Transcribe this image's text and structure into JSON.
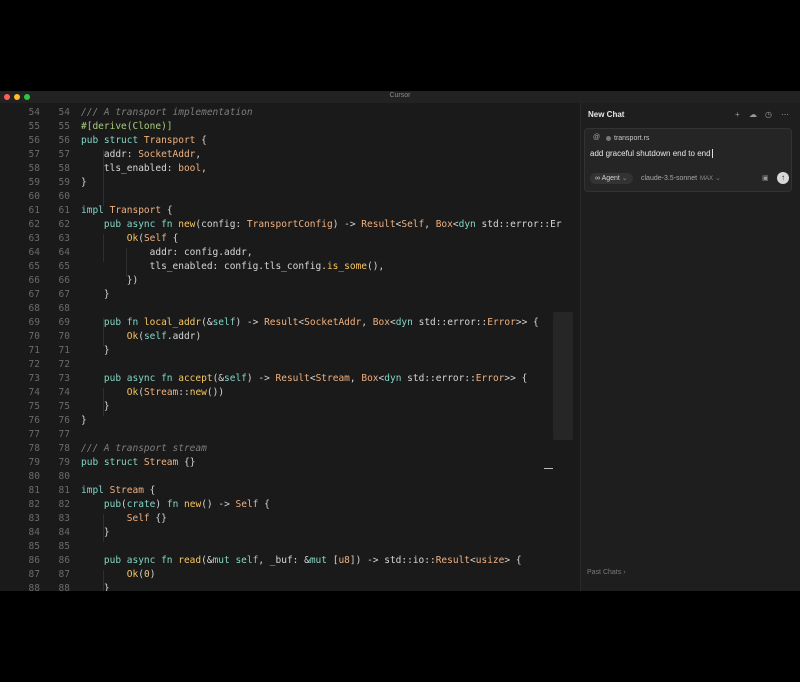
{
  "window": {
    "title": "Cursor"
  },
  "editor": {
    "lines": [
      {
        "n": "54",
        "tokens": [
          {
            "t": "/// A transport implementation",
            "c": "cm"
          }
        ]
      },
      {
        "n": "55",
        "tokens": [
          {
            "t": "#[derive(Clone)]",
            "c": "mac"
          }
        ]
      },
      {
        "n": "56",
        "tokens": [
          {
            "t": "pub struct ",
            "c": "kw"
          },
          {
            "t": "Transport",
            "c": "ty"
          },
          {
            "t": " {"
          }
        ]
      },
      {
        "n": "57",
        "tokens": [
          {
            "t": "    addr: "
          },
          {
            "t": "SocketAddr",
            "c": "ty"
          },
          {
            "t": ","
          }
        ]
      },
      {
        "n": "58",
        "tokens": [
          {
            "t": "    tls_enabled: "
          },
          {
            "t": "bool",
            "c": "ty"
          },
          {
            "t": ","
          }
        ]
      },
      {
        "n": "59",
        "tokens": [
          {
            "t": "}"
          }
        ]
      },
      {
        "n": "60",
        "tokens": []
      },
      {
        "n": "61",
        "tokens": [
          {
            "t": "impl ",
            "c": "kw"
          },
          {
            "t": "Transport",
            "c": "ty"
          },
          {
            "t": " {"
          }
        ]
      },
      {
        "n": "62",
        "tokens": [
          {
            "t": "    pub async fn ",
            "c": "kw"
          },
          {
            "t": "new",
            "c": "fn"
          },
          {
            "t": "(config: "
          },
          {
            "t": "TransportConfig",
            "c": "ty"
          },
          {
            "t": ") -> "
          },
          {
            "t": "Result",
            "c": "ty"
          },
          {
            "t": "<"
          },
          {
            "t": "Self",
            "c": "ty"
          },
          {
            "t": ", "
          },
          {
            "t": "Box",
            "c": "ty"
          },
          {
            "t": "<"
          },
          {
            "t": "dyn ",
            "c": "kw"
          },
          {
            "t": "std::error::Er"
          }
        ]
      },
      {
        "n": "63",
        "tokens": [
          {
            "t": "        "
          },
          {
            "t": "Ok",
            "c": "fn"
          },
          {
            "t": "("
          },
          {
            "t": "Self",
            "c": "ty"
          },
          {
            "t": " {"
          }
        ]
      },
      {
        "n": "64",
        "tokens": [
          {
            "t": "            addr: config.addr,"
          }
        ]
      },
      {
        "n": "65",
        "tokens": [
          {
            "t": "            tls_enabled: config.tls_config."
          },
          {
            "t": "is_some",
            "c": "fn"
          },
          {
            "t": "(),"
          }
        ]
      },
      {
        "n": "66",
        "tokens": [
          {
            "t": "        })"
          }
        ]
      },
      {
        "n": "67",
        "tokens": [
          {
            "t": "    }"
          }
        ]
      },
      {
        "n": "68",
        "tokens": []
      },
      {
        "n": "69",
        "tokens": [
          {
            "t": "    pub fn ",
            "c": "kw"
          },
          {
            "t": "local_addr",
            "c": "fn"
          },
          {
            "t": "(&"
          },
          {
            "t": "self",
            "c": "kw"
          },
          {
            "t": ") -> "
          },
          {
            "t": "Result",
            "c": "ty"
          },
          {
            "t": "<"
          },
          {
            "t": "SocketAddr",
            "c": "ty"
          },
          {
            "t": ", "
          },
          {
            "t": "Box",
            "c": "ty"
          },
          {
            "t": "<"
          },
          {
            "t": "dyn ",
            "c": "kw"
          },
          {
            "t": "std::error::"
          },
          {
            "t": "Error",
            "c": "ty"
          },
          {
            "t": ">> {"
          }
        ]
      },
      {
        "n": "70",
        "tokens": [
          {
            "t": "        "
          },
          {
            "t": "Ok",
            "c": "fn"
          },
          {
            "t": "("
          },
          {
            "t": "self",
            "c": "kw"
          },
          {
            "t": ".addr)"
          }
        ]
      },
      {
        "n": "71",
        "tokens": [
          {
            "t": "    }"
          }
        ]
      },
      {
        "n": "72",
        "tokens": []
      },
      {
        "n": "73",
        "tokens": [
          {
            "t": "    pub async fn ",
            "c": "kw"
          },
          {
            "t": "accept",
            "c": "fn"
          },
          {
            "t": "(&"
          },
          {
            "t": "self",
            "c": "kw"
          },
          {
            "t": ") -> "
          },
          {
            "t": "Result",
            "c": "ty"
          },
          {
            "t": "<"
          },
          {
            "t": "Stream",
            "c": "ty"
          },
          {
            "t": ", "
          },
          {
            "t": "Box",
            "c": "ty"
          },
          {
            "t": "<"
          },
          {
            "t": "dyn ",
            "c": "kw"
          },
          {
            "t": "std::error::"
          },
          {
            "t": "Error",
            "c": "ty"
          },
          {
            "t": ">> {"
          }
        ]
      },
      {
        "n": "74",
        "tokens": [
          {
            "t": "        "
          },
          {
            "t": "Ok",
            "c": "fn"
          },
          {
            "t": "("
          },
          {
            "t": "Stream",
            "c": "ty"
          },
          {
            "t": "::"
          },
          {
            "t": "new",
            "c": "fn"
          },
          {
            "t": "())"
          }
        ]
      },
      {
        "n": "75",
        "tokens": [
          {
            "t": "    }"
          }
        ]
      },
      {
        "n": "76",
        "tokens": [
          {
            "t": "}"
          }
        ]
      },
      {
        "n": "77",
        "tokens": []
      },
      {
        "n": "78",
        "tokens": [
          {
            "t": "/// A transport stream",
            "c": "cm"
          }
        ]
      },
      {
        "n": "79",
        "tokens": [
          {
            "t": "pub struct ",
            "c": "kw"
          },
          {
            "t": "Stream",
            "c": "ty"
          },
          {
            "t": " {}"
          }
        ]
      },
      {
        "n": "80",
        "tokens": []
      },
      {
        "n": "81",
        "tokens": [
          {
            "t": "impl ",
            "c": "kw"
          },
          {
            "t": "Stream",
            "c": "ty"
          },
          {
            "t": " {"
          }
        ]
      },
      {
        "n": "82",
        "tokens": [
          {
            "t": "    pub",
            "c": "kw"
          },
          {
            "t": "("
          },
          {
            "t": "crate",
            "c": "kw"
          },
          {
            "t": ") "
          },
          {
            "t": "fn ",
            "c": "kw"
          },
          {
            "t": "new",
            "c": "fn"
          },
          {
            "t": "() -> "
          },
          {
            "t": "Self",
            "c": "ty"
          },
          {
            "t": " {"
          }
        ]
      },
      {
        "n": "83",
        "tokens": [
          {
            "t": "        "
          },
          {
            "t": "Self",
            "c": "ty"
          },
          {
            "t": " {}"
          }
        ]
      },
      {
        "n": "84",
        "tokens": [
          {
            "t": "    }"
          }
        ]
      },
      {
        "n": "85",
        "tokens": []
      },
      {
        "n": "86",
        "tokens": [
          {
            "t": "    pub async fn ",
            "c": "kw"
          },
          {
            "t": "read",
            "c": "fn"
          },
          {
            "t": "(&"
          },
          {
            "t": "mut self",
            "c": "kw"
          },
          {
            "t": ", _buf: &"
          },
          {
            "t": "mut ",
            "c": "kw"
          },
          {
            "t": "["
          },
          {
            "t": "u8",
            "c": "ty"
          },
          {
            "t": "]) -> std::io::"
          },
          {
            "t": "Result",
            "c": "ty"
          },
          {
            "t": "<"
          },
          {
            "t": "usize",
            "c": "ty"
          },
          {
            "t": "> {"
          }
        ]
      },
      {
        "n": "87",
        "tokens": [
          {
            "t": "        "
          },
          {
            "t": "Ok",
            "c": "fn"
          },
          {
            "t": "("
          },
          {
            "t": "0",
            "c": "num"
          },
          {
            "t": ")"
          }
        ]
      },
      {
        "n": "88",
        "tokens": [
          {
            "t": "    }"
          }
        ]
      }
    ]
  },
  "chat": {
    "tab_label": "New Chat",
    "icons": [
      "plus-icon",
      "cloud-icon",
      "history-icon",
      "more-icon"
    ],
    "at_symbol": "@",
    "context_file": "transport.rs",
    "prompt": "add graceful shutdown end to end",
    "mode_label": "Agent",
    "model_label": "claude-3.5-sonnet",
    "model_badge": "MAX",
    "past_chats_label": "Past Chats"
  }
}
